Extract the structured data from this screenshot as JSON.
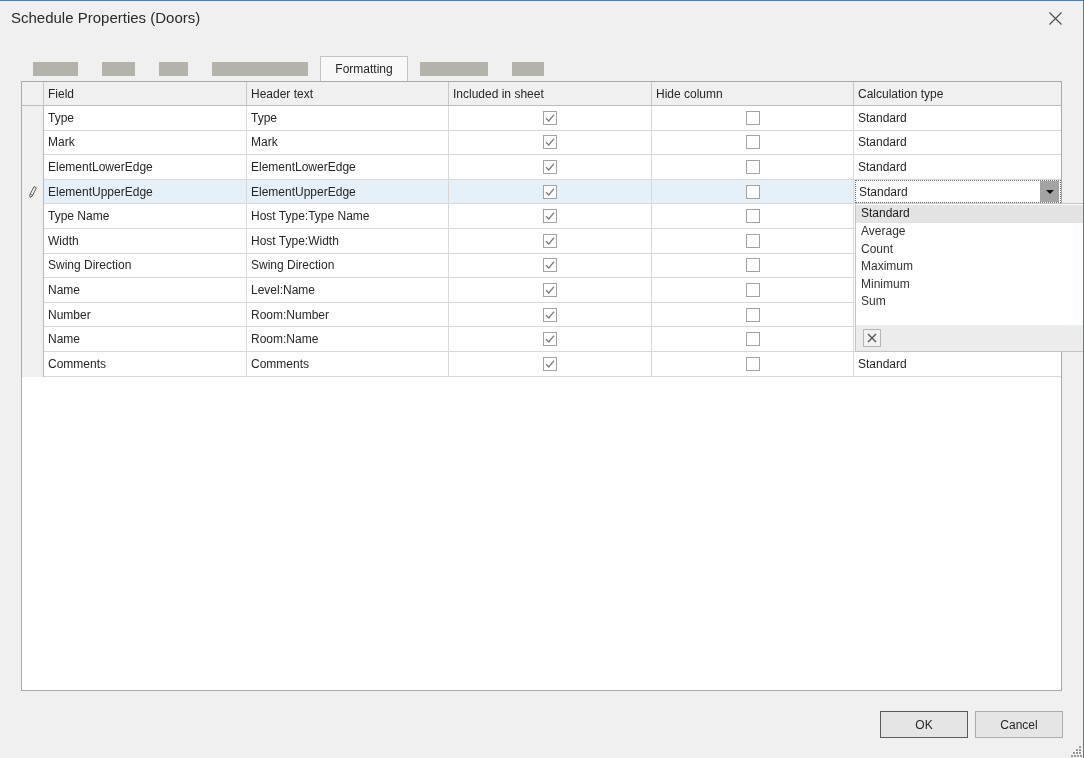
{
  "window": {
    "title": "Schedule Properties (Doors)"
  },
  "tabs": [
    {
      "kind": "redacted",
      "selected": false
    },
    {
      "kind": "redacted",
      "selected": false
    },
    {
      "kind": "redacted",
      "selected": false
    },
    {
      "kind": "redacted",
      "selected": false
    },
    {
      "kind": "label",
      "label": "Formatting",
      "selected": true
    },
    {
      "kind": "redacted",
      "selected": false
    },
    {
      "kind": "redacted",
      "selected": false
    }
  ],
  "table": {
    "columns": [
      "Field",
      "Header text",
      "Included in sheet",
      "Hide column",
      "Calculation type"
    ],
    "rows": [
      {
        "field": "Type",
        "header_text": "Type",
        "included_in_sheet": true,
        "hide_column": false,
        "calculation_type": "Standard",
        "selected": false,
        "editing": false
      },
      {
        "field": "Mark",
        "header_text": "Mark",
        "included_in_sheet": true,
        "hide_column": false,
        "calculation_type": "Standard",
        "selected": false,
        "editing": false
      },
      {
        "field": "ElementLowerEdge",
        "header_text": "ElementLowerEdge",
        "included_in_sheet": true,
        "hide_column": false,
        "calculation_type": "Standard",
        "selected": false,
        "editing": false
      },
      {
        "field": "ElementUpperEdge",
        "header_text": "ElementUpperEdge",
        "included_in_sheet": true,
        "hide_column": false,
        "calculation_type": "Standard",
        "selected": true,
        "editing": true
      },
      {
        "field": "Type Name",
        "header_text": "Host Type:Type Name",
        "included_in_sheet": true,
        "hide_column": false,
        "selected": false,
        "editing": false
      },
      {
        "field": "Width",
        "header_text": "Host Type:Width",
        "included_in_sheet": true,
        "hide_column": false,
        "selected": false,
        "editing": false
      },
      {
        "field": "Swing Direction",
        "header_text": "Swing Direction",
        "included_in_sheet": true,
        "hide_column": false,
        "selected": false,
        "editing": false
      },
      {
        "field": "Name",
        "header_text": "Level:Name",
        "included_in_sheet": true,
        "hide_column": false,
        "selected": false,
        "editing": false
      },
      {
        "field": "Number",
        "header_text": "Room:Number",
        "included_in_sheet": true,
        "hide_column": false,
        "selected": false,
        "editing": false
      },
      {
        "field": "Name",
        "header_text": "Room:Name",
        "included_in_sheet": true,
        "hide_column": false,
        "selected": false,
        "editing": false
      },
      {
        "field": "Comments",
        "header_text": "Comments",
        "included_in_sheet": true,
        "hide_column": false,
        "calculation_type": "Standard",
        "selected": false,
        "editing": false
      }
    ]
  },
  "dropdown": {
    "expanded": true,
    "options": [
      {
        "label": "Standard",
        "selected": true
      },
      {
        "label": "Average",
        "selected": false
      },
      {
        "label": "Count",
        "selected": false
      },
      {
        "label": "Maximum",
        "selected": false
      },
      {
        "label": "Minimum",
        "selected": false
      },
      {
        "label": "Sum",
        "selected": false
      }
    ]
  },
  "buttons": [
    {
      "label": "OK",
      "default": true
    },
    {
      "label": "Cancel",
      "default": false
    }
  ]
}
